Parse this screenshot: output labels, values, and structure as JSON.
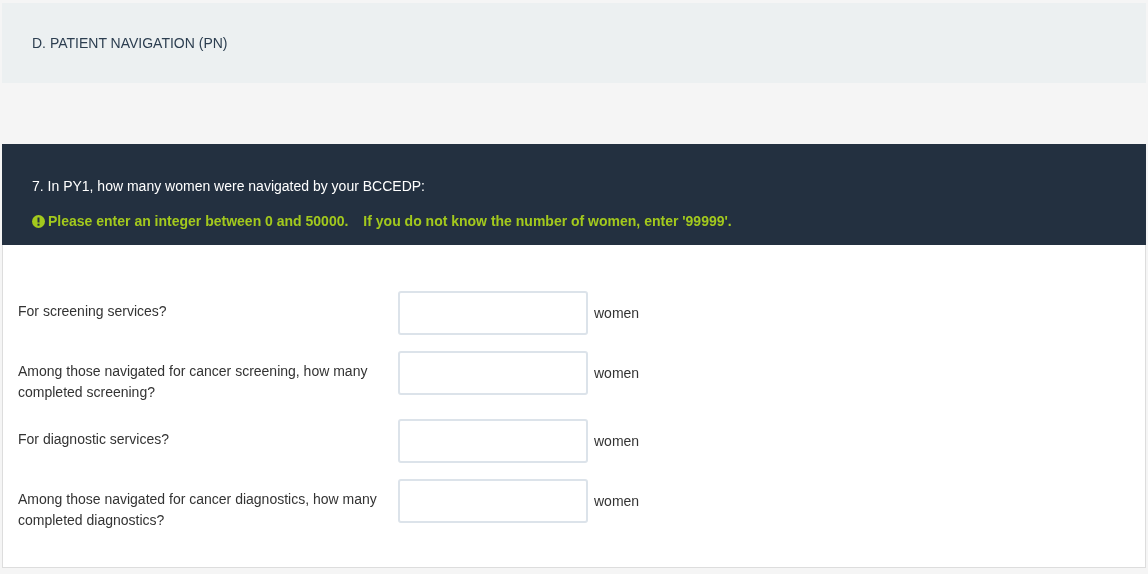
{
  "section": {
    "title": "D. PATIENT NAVIGATION (PN)"
  },
  "question": {
    "title": "7. In PY1, how many women were navigated by your BCCEDP:",
    "notes": [
      "Please enter an integer between 0 and 50000.",
      "If you do not know the number of women, enter '99999'."
    ]
  },
  "fields": [
    {
      "label": "For screening services?",
      "unit": "women"
    },
    {
      "label": "Among those navigated for cancer screening, how many completed screening?",
      "unit": "women"
    },
    {
      "label": "For diagnostic services?",
      "unit": "women"
    },
    {
      "label": "Among those navigated for cancer diagnostics, how many completed diagnostics?",
      "unit": "women"
    }
  ]
}
